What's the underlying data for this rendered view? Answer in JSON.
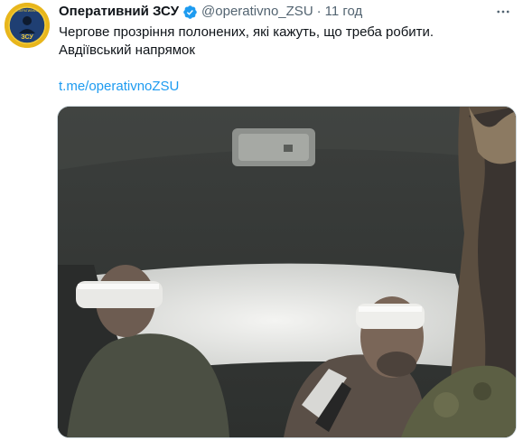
{
  "tweet": {
    "author_name": "Оперативний ЗСУ",
    "handle": "@operativno_ZSU",
    "separator": "·",
    "time": "11 год",
    "text_lines": [
      "Чергове прозріння полонених, які кажуть, що треба робити.",
      "Авдіївський напрямок"
    ],
    "link": "t.me/operativnoZSU",
    "avatar_text": "ЗСУ",
    "avatar_small_text": "ОПЕРАТИВНИЙ"
  },
  "icons": {
    "verified": "verified-badge-icon",
    "more": "more-options-icon"
  },
  "colors": {
    "link": "#1d9bf0",
    "verified": "#1d9bf0",
    "secondary_text": "#536471",
    "avatar_bg": "#e8b61c"
  }
}
